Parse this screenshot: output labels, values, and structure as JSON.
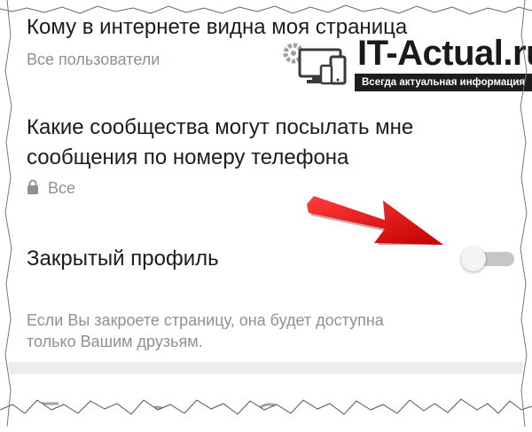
{
  "settings": {
    "visibility": {
      "title": "Кому в интернете видна моя страница",
      "value": "Все пользователи"
    },
    "communities": {
      "title_line1": "Какие сообщества могут посылать мне",
      "title_line2": "сообщения по номеру телефона",
      "value": "Все"
    },
    "closed_profile": {
      "title": "Закрытый профиль",
      "enabled": false,
      "hint_line1": "Если Вы закроете страницу, она будет доступна",
      "hint_line2": "только Вашим друзьям."
    }
  },
  "watermark": {
    "title": "IT-Actual.ru",
    "subtitle": "Всегда актуальная информация"
  },
  "tabbar": {
    "icons": [
      "news-icon",
      "search-icon",
      "messages-icon",
      "menu-icon"
    ],
    "active_color": "#4a76a8"
  }
}
